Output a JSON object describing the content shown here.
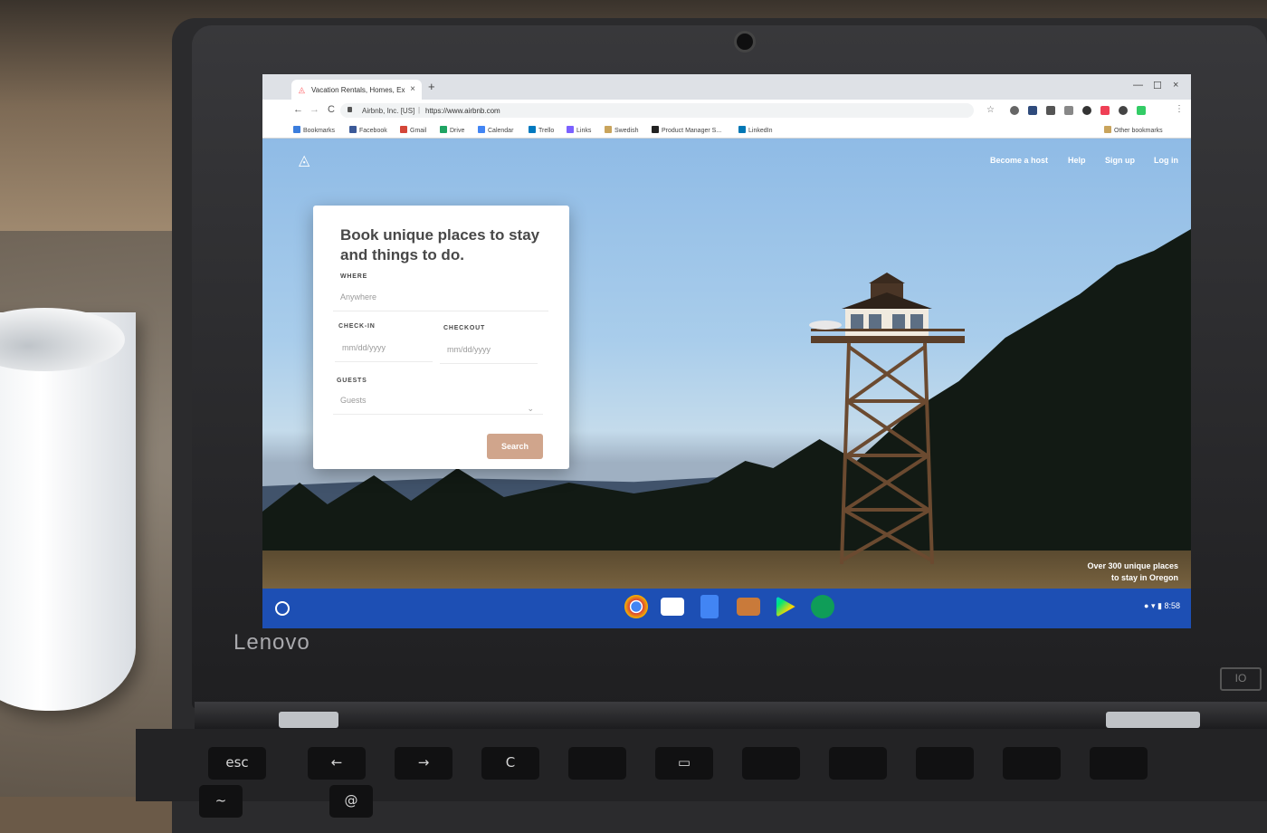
{
  "device": {
    "brand": "Lenovo",
    "power_label": "IO"
  },
  "keyboard": {
    "esc": "esc",
    "back": "←",
    "forward": "→",
    "refresh": "C",
    "switcher": "▭",
    "tilde": "~",
    "at": "@"
  },
  "browser": {
    "tab_title": "Vacation Rentals, Homes, Experi",
    "tab_close": "×",
    "new_tab": "+",
    "window_controls": [
      "—",
      "☐",
      "×"
    ],
    "nav": {
      "back": "←",
      "forward": "→",
      "reload": "C"
    },
    "site_identity": "Airbnb, Inc. [US]",
    "url": "https://www.airbnb.com",
    "menu": "⋮"
  },
  "bookmarks": {
    "items": [
      {
        "label": "Bookmarks",
        "icon": "star-icon",
        "color": "#3b7ddd"
      },
      {
        "label": "Facebook",
        "icon": "facebook-icon",
        "color": "#3b5998"
      },
      {
        "label": "Gmail",
        "icon": "gmail-icon",
        "color": "#d44638"
      },
      {
        "label": "Drive",
        "icon": "drive-icon",
        "color": "#1fa463"
      },
      {
        "label": "Calendar",
        "icon": "calendar-icon",
        "color": "#4285f4"
      },
      {
        "label": "Trello",
        "icon": "trello-icon",
        "color": "#0079bf"
      },
      {
        "label": "Links",
        "icon": "links-icon",
        "color": "#7b61ff"
      },
      {
        "label": "Swedish",
        "icon": "folder-icon",
        "color": "#c9a45c"
      },
      {
        "label": "Product Manager S...",
        "icon": "medium-icon",
        "color": "#222222"
      },
      {
        "label": "LinkedIn",
        "icon": "linkedin-icon",
        "color": "#0077b5"
      }
    ],
    "other": "Other bookmarks"
  },
  "airbnb": {
    "logo_icon": "airbnb-logo-icon",
    "nav": {
      "host": "Become a host",
      "help": "Help",
      "signup": "Sign up",
      "login": "Log in"
    },
    "card": {
      "title": "Book unique places to stay and things to do.",
      "where_label": "WHERE",
      "where_placeholder": "Anywhere",
      "checkin_label": "CHECK-IN",
      "checkin_placeholder": "mm/dd/yyyy",
      "checkout_label": "CHECKOUT",
      "checkout_placeholder": "mm/dd/yyyy",
      "guests_label": "GUESTS",
      "guests_value": "Guests",
      "guests_chevron": "⌄",
      "search_label": "Search"
    },
    "caption_line1": "Over 300 unique places",
    "caption_line2": "to stay in Oregon"
  },
  "shelf": {
    "apps": [
      "chrome-icon",
      "gmail-icon",
      "docs-icon",
      "youtube-icon",
      "play-store-icon",
      "hangouts-icon"
    ],
    "time": "8:58"
  },
  "colors": {
    "airbnb_search": "#d0a58c",
    "shelf": "#1d4fb4"
  }
}
